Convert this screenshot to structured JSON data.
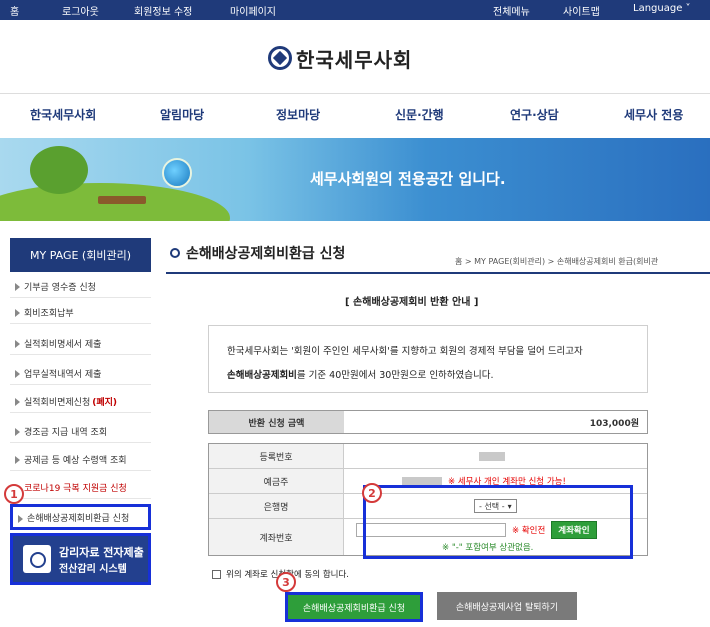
{
  "topbar": {
    "left": [
      "홈",
      "로그아웃",
      "회원정보 수정",
      "마이페이지"
    ],
    "right": [
      "전체메뉴",
      "사이트맵",
      "Language"
    ]
  },
  "logo": {
    "text": "한국세무사회"
  },
  "nav": [
    "한국세무사회",
    "알림마당",
    "정보마당",
    "신문·간행",
    "연구·상담",
    "세무사 전용"
  ],
  "banner": {
    "text": "세무사회원의 전용공간 입니다."
  },
  "sidebar": {
    "title": "MY PAGE (회비관리)",
    "items": [
      {
        "label": "기부금 영수증 신청"
      },
      {
        "label": "회비조회납부"
      },
      {
        "label": "실적회비명세서 제출"
      },
      {
        "label": "업무실적내역서 제출"
      },
      {
        "label": "실적회비면제신청",
        "suffix": "(폐지)"
      },
      {
        "label": "경조금 지급 내역 조회"
      },
      {
        "label": "공제금 등 예상 수령액 조회"
      },
      {
        "label": "코로나19 극복 지원금 신청"
      },
      {
        "label": "손해배상공제회비환급 신청"
      }
    ],
    "electronic": {
      "line1": "감리자료 전자제출",
      "line2": "전산감리 시스템"
    }
  },
  "main": {
    "title": "손해배상공제회비환급 신청",
    "breadcrumb": "홈 > MY PAGE(회비관리) > 손해배상공제회비 환급(회비관",
    "sub_heading": "[ 손해배상공제회비 반환 안내 ]",
    "notice_line1": "한국세무사회는 '회원이 주인인 세무사회'를 지향하고 회원의 경제적 부담을 덜어 드리고자",
    "notice_bold": "손해배상공제회비",
    "notice_line2_rest": "를 기준 40만원에서 30만원으로 인하하였습니다.",
    "refund": {
      "label": "반환 신청 금액",
      "value": "103,000원"
    },
    "form": {
      "reg_no_label": "등록번호",
      "holder_label": "예금주",
      "holder_warning": "※ 세무사 개인 계좌만 신청 가능!",
      "bank_label": "은행명",
      "bank_select": "- 선택 -",
      "account_label": "계좌번호",
      "account_confirm_note": "※ 확인전",
      "account_check_button": "계좌확인",
      "account_hint": "※ \"-\" 포함여부 상관없음."
    },
    "agree_text": "위의 계좌로 신청함에 동의 합니다.",
    "apply_button": "손해배상공제회비환급 신청",
    "withdraw_button": "손해배상공제사업 탈퇴하기"
  },
  "markers": [
    "1",
    "2",
    "3"
  ]
}
